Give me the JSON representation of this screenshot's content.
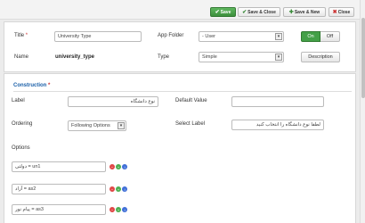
{
  "toolbar": {
    "save": "Save",
    "save_close": "Save & Close",
    "save_new": "Save & New",
    "close": "Close"
  },
  "general": {
    "title_label": "Title",
    "title_required": "*",
    "title_value": "University Type",
    "app_folder_label": "App Folder",
    "app_folder_value": "- User",
    "toggle_on": "On",
    "toggle_off": "Off",
    "name_label": "Name",
    "name_value": "university_type",
    "type_label": "Type",
    "type_value": "Simple",
    "description_button": "Description"
  },
  "construction": {
    "section_title": "Construction",
    "section_required": "*",
    "label_label": "Label",
    "label_value": "نوع دانشگاه",
    "default_value_label": "Default Value",
    "default_value_value": "",
    "ordering_label": "Ordering",
    "ordering_value": "Following Options",
    "select_label_label": "Select Label",
    "select_label_value": "لطفا نوع دانشگاه را انتخاب کنید",
    "options_label": "Options",
    "options": [
      {
        "text": "دولتی = un1"
      },
      {
        "text": "آزاد = as2"
      },
      {
        "text": "پیام نور = as3"
      }
    ]
  },
  "icons": {
    "minus": "remove-option-icon",
    "plus": "add-option-icon",
    "move": "move-option-icon"
  }
}
